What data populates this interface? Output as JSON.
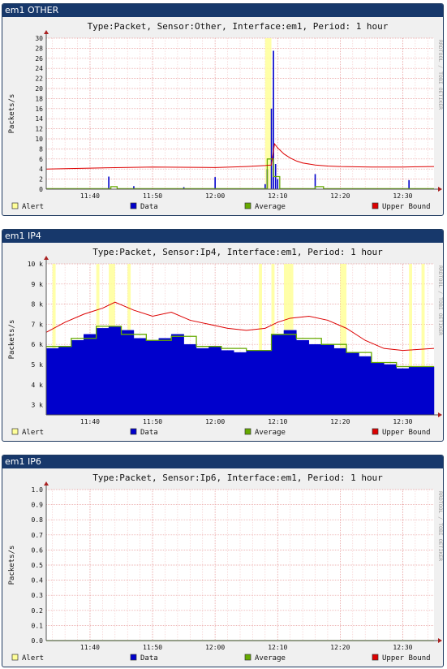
{
  "watermark": "RRDTOOL / TOBI OETIKER",
  "legend": [
    {
      "label": "Alert",
      "color": "#ffff99"
    },
    {
      "label": "Data",
      "color": "#0000cc"
    },
    {
      "label": "Average",
      "color": "#66aa00"
    },
    {
      "label": "Upper Bound",
      "color": "#dd0000"
    }
  ],
  "panels": [
    {
      "header": "em1 OTHER",
      "title": "Type:Packet, Sensor:Other, Interface:em1, Period: 1 hour"
    },
    {
      "header": "em1 IP4",
      "title": "Type:Packet, Sensor:Ip4, Interface:em1, Period: 1 hour"
    },
    {
      "header": "em1 IP6",
      "title": "Type:Packet, Sensor:Ip6, Interface:em1, Period: 1 hour"
    }
  ],
  "chart_data": [
    {
      "type": "area",
      "ylabel": "Packets/s",
      "ylim": [
        0,
        30
      ],
      "xlim": [
        "11:33",
        "12:35"
      ],
      "yticks": [
        "0",
        "2",
        "4",
        "6",
        "8",
        "10",
        "12",
        "14",
        "16",
        "18",
        "20",
        "22",
        "24",
        "26",
        "28",
        "30"
      ],
      "xticks": [
        "11:40",
        "11:50",
        "12:00",
        "12:10",
        "12:20",
        "12:30"
      ],
      "grid": true,
      "legend_position": "bottom",
      "series": [
        {
          "name": "Data",
          "style": "spikes",
          "x": [
            "11:43",
            "11:47",
            "11:55",
            "12:00",
            "12:08",
            "12:08:20",
            "12:09",
            "12:09:20",
            "12:09:40",
            "12:10",
            "12:16",
            "12:31"
          ],
          "values": [
            2.5,
            0.6,
            0.4,
            2.4,
            1.0,
            4.0,
            16.0,
            27.5,
            5.0,
            2.0,
            3.0,
            1.8
          ]
        },
        {
          "name": "Average",
          "style": "step",
          "x": [
            "11:33",
            "11:43",
            "11:43:20",
            "11:44",
            "11:44:20",
            "12:08",
            "12:08:20",
            "12:09",
            "12:09:20",
            "12:10",
            "12:10:20",
            "12:15:40",
            "12:16",
            "12:17",
            "12:17:20",
            "12:35"
          ],
          "values": [
            0.1,
            0.1,
            0.5,
            0.5,
            0.1,
            0.1,
            6.0,
            6.0,
            2.5,
            2.5,
            0.1,
            0.1,
            0.5,
            0.5,
            0.1,
            0.1
          ]
        },
        {
          "name": "Upper Bound",
          "x": [
            "11:33",
            "11:45",
            "11:50",
            "12:00",
            "12:05",
            "12:08",
            "12:09",
            "12:09:30",
            "12:10",
            "12:11",
            "12:12",
            "12:13",
            "12:14",
            "12:16",
            "12:18",
            "12:20",
            "12:25",
            "12:30",
            "12:35"
          ],
          "values": [
            4.0,
            4.3,
            4.4,
            4.3,
            4.5,
            4.7,
            4.8,
            9.0,
            8.2,
            7.0,
            6.2,
            5.6,
            5.2,
            4.8,
            4.6,
            4.5,
            4.4,
            4.4,
            4.5
          ]
        }
      ],
      "alerts": [
        [
          "12:08",
          "12:09"
        ]
      ]
    },
    {
      "type": "area",
      "ylabel": "Packets/s",
      "ylim": [
        2500,
        10000
      ],
      "xlim": [
        "11:33",
        "12:35"
      ],
      "yticks": [
        "3 k",
        "4 k",
        "5 k",
        "6 k",
        "7 k",
        "8 k",
        "9 k",
        "10 k"
      ],
      "xticks": [
        "11:40",
        "11:50",
        "12:00",
        "12:10",
        "12:20",
        "12:30"
      ],
      "grid": true,
      "legend_position": "bottom",
      "series": [
        {
          "name": "Data",
          "style": "area",
          "x": [
            "11:33",
            "11:35",
            "11:37",
            "11:39",
            "11:41",
            "11:43",
            "11:45",
            "11:47",
            "11:49",
            "11:51",
            "11:53",
            "11:55",
            "11:57",
            "11:59",
            "12:01",
            "12:03",
            "12:05",
            "12:07",
            "12:09",
            "12:11",
            "12:13",
            "12:15",
            "12:17",
            "12:19",
            "12:21",
            "12:23",
            "12:25",
            "12:27",
            "12:29",
            "12:31",
            "12:35"
          ],
          "values": [
            5800,
            5900,
            6200,
            6500,
            6800,
            6900,
            6700,
            6300,
            6200,
            6300,
            6500,
            6000,
            5800,
            5900,
            5700,
            5600,
            5700,
            5700,
            6500,
            6700,
            6200,
            6000,
            6000,
            5800,
            5600,
            5400,
            5100,
            5000,
            4800,
            4900,
            4900
          ]
        },
        {
          "name": "Average",
          "style": "step",
          "x": [
            "11:33",
            "11:37",
            "11:41",
            "11:45",
            "11:49",
            "11:53",
            "11:57",
            "12:01",
            "12:05",
            "12:09",
            "12:13",
            "12:17",
            "12:21",
            "12:25",
            "12:29",
            "12:35"
          ],
          "values": [
            5900,
            6300,
            6900,
            6500,
            6200,
            6400,
            5900,
            5800,
            5700,
            6500,
            6300,
            6000,
            5600,
            5100,
            4900,
            4900
          ]
        },
        {
          "name": "Upper Bound",
          "x": [
            "11:33",
            "11:36",
            "11:39",
            "11:42",
            "11:44",
            "11:47",
            "11:50",
            "11:53",
            "11:56",
            "11:59",
            "12:02",
            "12:05",
            "12:08",
            "12:10",
            "12:12",
            "12:15",
            "12:18",
            "12:21",
            "12:24",
            "12:27",
            "12:30",
            "12:35"
          ],
          "values": [
            6600,
            7100,
            7500,
            7800,
            8100,
            7700,
            7400,
            7600,
            7200,
            7000,
            6800,
            6700,
            6800,
            7100,
            7300,
            7400,
            7200,
            6800,
            6200,
            5800,
            5700,
            5800
          ]
        }
      ],
      "alerts": [
        [
          "11:34",
          "11:34:30"
        ],
        [
          "11:41",
          "11:41:30"
        ],
        [
          "11:43",
          "11:44"
        ],
        [
          "11:46",
          "11:46:30"
        ],
        [
          "12:07",
          "12:07:30"
        ],
        [
          "12:09",
          "12:09:30"
        ],
        [
          "12:11",
          "12:12:30"
        ],
        [
          "12:20",
          "12:21"
        ],
        [
          "12:31",
          "12:31:30"
        ],
        [
          "12:33",
          "12:33:30"
        ]
      ]
    },
    {
      "type": "line",
      "ylabel": "Packets/s",
      "ylim": [
        0,
        1.0
      ],
      "xlim": [
        "11:33",
        "12:35"
      ],
      "yticks": [
        "0.0",
        "0.1",
        "0.2",
        "0.3",
        "0.4",
        "0.5",
        "0.6",
        "0.7",
        "0.8",
        "0.9",
        "1.0"
      ],
      "xticks": [
        "11:40",
        "11:50",
        "12:00",
        "12:10",
        "12:20",
        "12:30"
      ],
      "grid": true,
      "legend_position": "bottom",
      "series": [
        {
          "name": "Upper Bound",
          "x": [
            "11:33",
            "12:35"
          ],
          "values": [
            0,
            0
          ]
        },
        {
          "name": "Average",
          "style": "step",
          "x": [
            "11:33",
            "12:35"
          ],
          "values": [
            0,
            0
          ]
        }
      ],
      "alerts": []
    }
  ]
}
